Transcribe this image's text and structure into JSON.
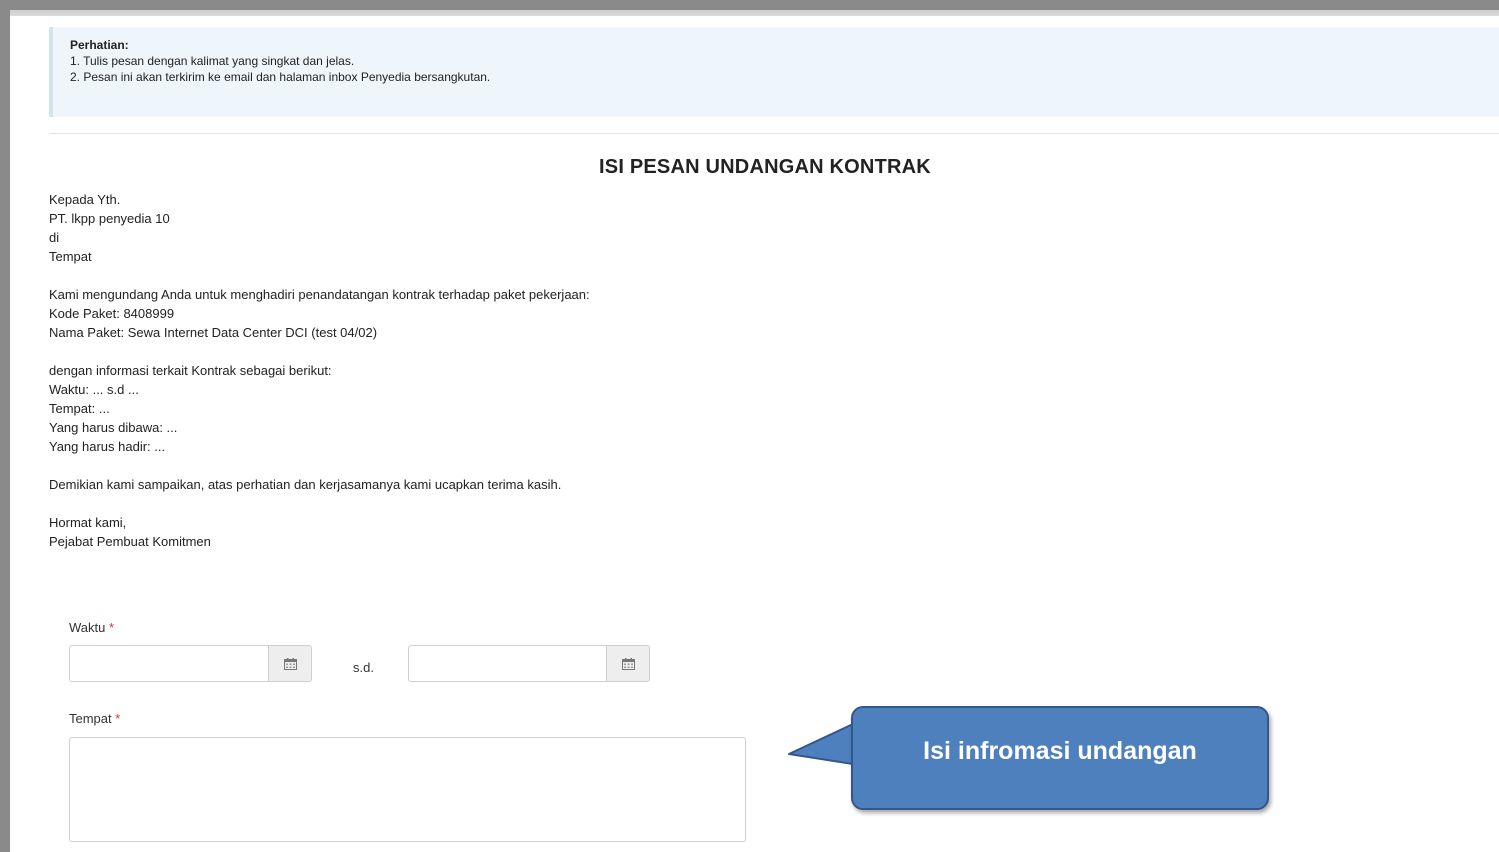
{
  "notice": {
    "title": "Perhatian:",
    "items": [
      "1. Tulis pesan dengan kalimat yang singkat dan jelas.",
      "2. Pesan ini akan terkirim ke email dan halaman inbox Penyedia bersangkutan."
    ]
  },
  "heading": "ISI PESAN UNDANGAN KONTRAK",
  "message_lines": [
    "Kepada Yth.",
    "PT. lkpp penyedia 10",
    "di",
    "Tempat",
    "",
    "Kami mengundang Anda untuk menghadiri penandatangan kontrak terhadap paket pekerjaan:",
    "Kode Paket: 8408999",
    "Nama Paket: Sewa Internet Data Center DCI (test 04/02)",
    "",
    "dengan informasi terkait Kontrak sebagai berikut:",
    "Waktu: ... s.d ...",
    "Tempat: ...",
    "Yang harus dibawa: ...",
    "Yang harus hadir: ...",
    "",
    "Demikian kami sampaikan, atas perhatian dan kerjasamanya kami ucapkan terima kasih.",
    "",
    "Hormat kami,",
    "Pejabat Pembuat Komitmen"
  ],
  "form": {
    "waktu_label": "Waktu",
    "required_mark": "*",
    "waktu_start_value": "",
    "range_separator": "s.d.",
    "waktu_end_value": "",
    "tempat_label": "Tempat",
    "tempat_value": ""
  },
  "icons": {
    "calendar": "calendar-icon"
  },
  "callout": {
    "text": "Isi infromasi undangan",
    "fill_color": "#4e80bd",
    "border_color": "#34568c"
  }
}
